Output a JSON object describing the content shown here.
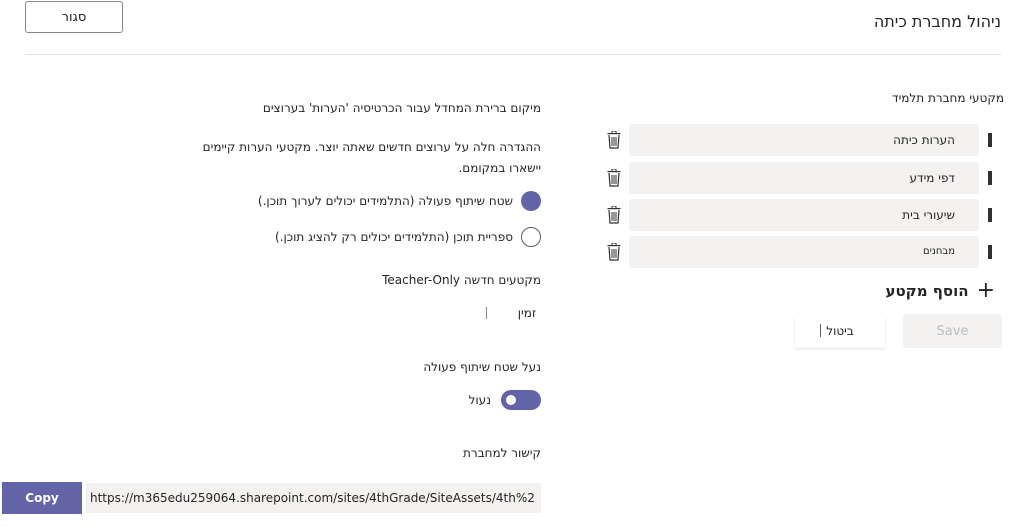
{
  "header": {
    "close_label": "סגור",
    "title": "ניהול מחברת כיתה"
  },
  "sections": {
    "heading": "מקטעי מחברת תלמיד",
    "items": [
      {
        "label": "הערות כיתה"
      },
      {
        "label": "דפי מידע"
      },
      {
        "label": "שיעורי בית"
      },
      {
        "label": "מבחנים"
      }
    ],
    "add_label": "הוסף מקטע",
    "save_label": "Save",
    "cancel_label": "ביטול"
  },
  "settings": {
    "location_text": "מיקום ברירת המחדל עבור הכרטיסיה 'הערות' בערוצים",
    "note_text": "ההגדרה חלה על ערוצים חדשים שאתה יוצר. מקטעי הערות קיימים יישארו במקומם.",
    "radio1_label": "שטח שיתוף פעולה (התלמידים יכולים לערוך תוכן.)",
    "radio2_label": "ספריית תוכן (התלמידים יכולים רק להציג תוכן.)",
    "teacher_only_heading": "מקטעים חדשה Teacher-Only",
    "time_label": "זמין",
    "lock_heading": "נעל שטח שיתוף פעולה",
    "toggle_label": "נעול",
    "link_heading": "קישור למחברת",
    "link_value": "https://m365edu259064.sharepoint.com/sites/4thGrade/SiteAssets/4th%2",
    "copy_label": "Copy"
  },
  "colors": {
    "accent": "#6264a7",
    "field_bg": "#f3f2f1"
  }
}
